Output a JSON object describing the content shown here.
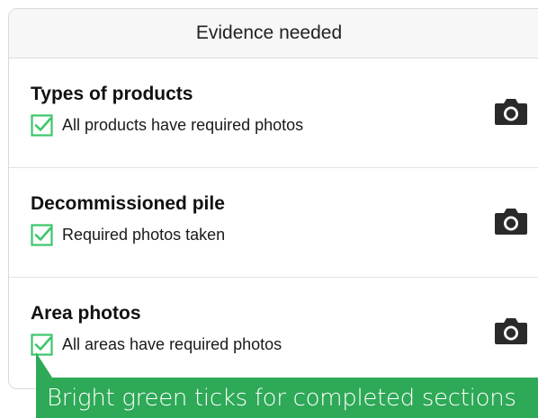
{
  "header": {
    "title": "Evidence needed"
  },
  "sections": [
    {
      "title": "Types of products",
      "status": "All products have required photos",
      "status_icon": "check-icon",
      "action_icon": "camera-icon"
    },
    {
      "title": "Decommissioned pile",
      "status": "Required photos taken",
      "status_icon": "check-icon",
      "action_icon": "camera-icon"
    },
    {
      "title": "Area photos",
      "status": "All areas have required photos",
      "status_icon": "check-icon",
      "action_icon": "camera-icon"
    }
  ],
  "callout": {
    "text": "Bright green ticks for completed sections"
  },
  "colors": {
    "accent_green": "#2ea957",
    "check_green": "#3cc66a",
    "header_bg": "#f7f7f7",
    "camera": "#2a2a2a"
  }
}
